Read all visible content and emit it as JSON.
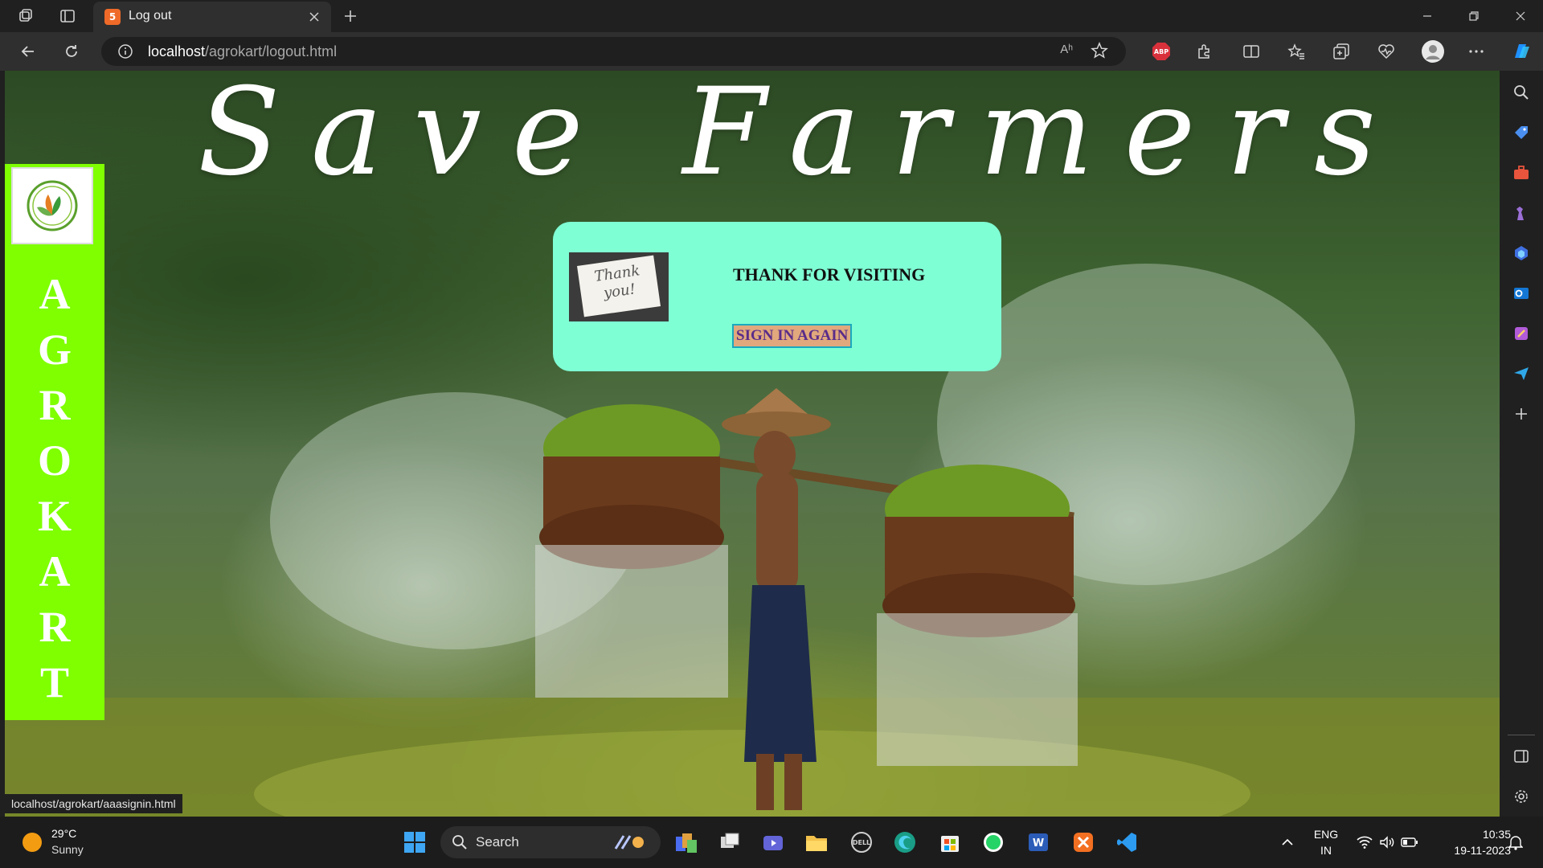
{
  "browser": {
    "tab_title": "Log out",
    "tab_favicon": "html5",
    "url_host": "localhost",
    "url_path": "/agrokart/logout.html",
    "read_aloud": "Aʰ"
  },
  "page": {
    "headline": "Save Farmers",
    "brand_letters": [
      "A",
      "G",
      "R",
      "O",
      "K",
      "A",
      "R",
      "T"
    ],
    "card": {
      "thumb_text": "Thank you!",
      "heading": "THANK FOR VISITING",
      "button": "SIGN IN AGAIN"
    },
    "status_url": "localhost/agrokart/aaasignin.html"
  },
  "colors": {
    "brand_bar": "#7fff00",
    "card_bg": "#7fffd4",
    "button_bg": "#e0a87c",
    "button_border": "#1aa9c0",
    "button_text": "#5a2c8a"
  },
  "taskbar": {
    "weather_temp": "29°C",
    "weather_cond": "Sunny",
    "search_label": "Search",
    "lang_top": "ENG",
    "lang_bottom": "IN",
    "time": "10:35",
    "date": "19-11-2023"
  }
}
